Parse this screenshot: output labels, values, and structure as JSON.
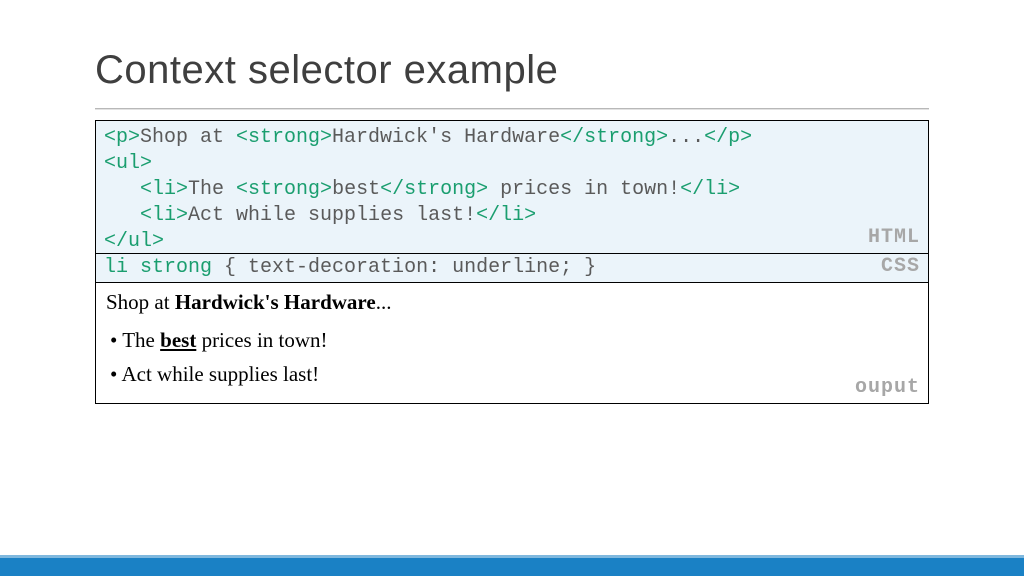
{
  "title": "Context selector example",
  "labels": {
    "html": "HTML",
    "css": "CSS",
    "output": "ouput"
  },
  "html_code": {
    "l1_o_p": "<p>",
    "l1_t1": "Shop at ",
    "l1_o_strong": "<strong>",
    "l1_t2": "Hardwick's Hardware",
    "l1_c_strong": "</strong>",
    "l1_t3": "...",
    "l1_c_p": "</p>",
    "l2": "<ul>",
    "l3_pad": "   ",
    "l3_o_li": "<li>",
    "l3_t1": "The ",
    "l3_o_strong": "<strong>",
    "l3_t2": "best",
    "l3_c_strong": "</strong>",
    "l3_t3": " prices in town!",
    "l3_c_li": "</li>",
    "l4_pad": "   ",
    "l4_o_li": "<li>",
    "l4_t1": "Act while supplies last!",
    "l4_c_li": "</li>",
    "l5": "</ul>"
  },
  "css_code": {
    "selector": "li strong",
    "body": " { text-decoration: underline; }"
  },
  "output": {
    "p_before": "Shop at ",
    "p_strong": "Hardwick's Hardware",
    "p_after": "...",
    "li1_before": "The ",
    "li1_strong": "best",
    "li1_after": " prices in town!",
    "li2": "Act while supplies last!"
  }
}
